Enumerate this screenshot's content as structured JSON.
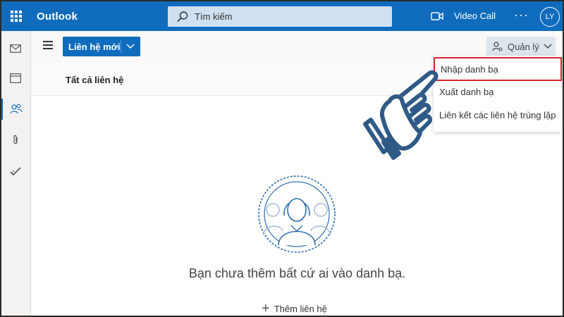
{
  "app": {
    "name": "Outlook"
  },
  "search": {
    "placeholder": "Tìm kiếm"
  },
  "header": {
    "video_call": "Video Call",
    "more": "···",
    "avatar_initials": "LY"
  },
  "toolbar": {
    "new_contact": "Liên hệ mới",
    "manage": "Quản lý"
  },
  "content": {
    "title": "Tất cả liên hệ",
    "empty_message": "Bạn chưa thêm bất cứ ai vào danh bạ.",
    "add_contact": "Thêm liên hệ"
  },
  "dropdown": {
    "items": [
      {
        "label": "Nhập danh bạ"
      },
      {
        "label": "Xuất danh bạ"
      },
      {
        "label": "Liên kết các liên hệ trùng lặp"
      }
    ]
  },
  "colors": {
    "brand": "#0f6cbd",
    "highlight_border": "#d9232d",
    "hand_fill": "#ffffff",
    "hand_stroke": "#2f5a87"
  }
}
